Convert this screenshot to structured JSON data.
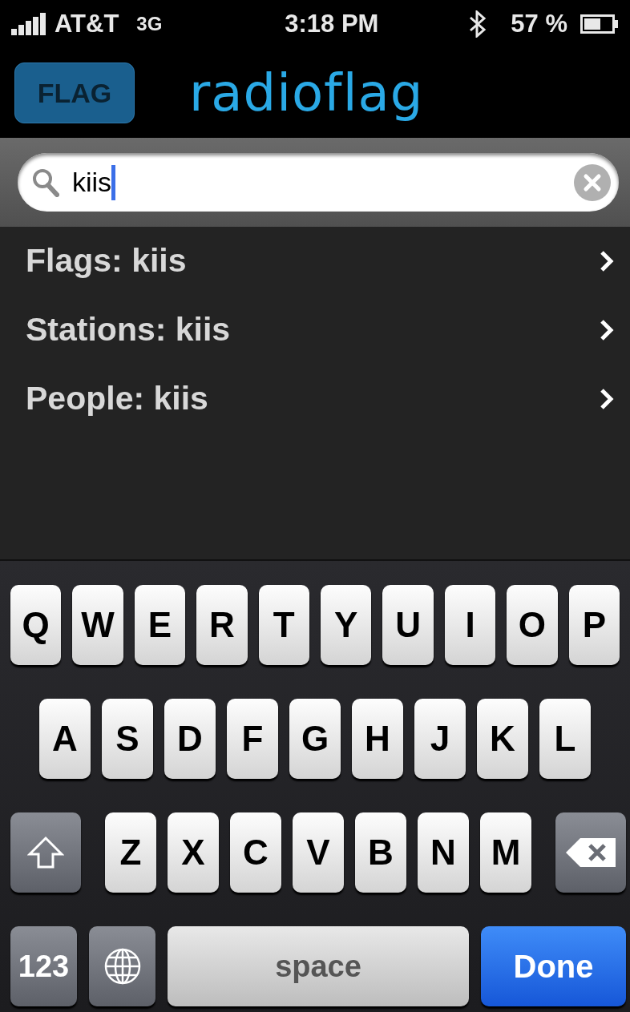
{
  "status_bar": {
    "carrier": "AT&T",
    "network": "3G",
    "time": "3:18 PM",
    "battery": "57 %"
  },
  "header": {
    "flag_button": "FLAG",
    "logo": "radioflag"
  },
  "search": {
    "value": "kiis"
  },
  "results": [
    {
      "label": "Flags: kiis"
    },
    {
      "label": "Stations: kiis"
    },
    {
      "label": "People: kiis"
    }
  ],
  "keyboard": [
    [
      {
        "kind": "letter",
        "label": "Q"
      },
      {
        "kind": "letter",
        "label": "W"
      },
      {
        "kind": "letter",
        "label": "E"
      },
      {
        "kind": "letter",
        "label": "R"
      },
      {
        "kind": "letter",
        "label": "T"
      },
      {
        "kind": "letter",
        "label": "Y"
      },
      {
        "kind": "letter",
        "label": "U"
      },
      {
        "kind": "letter",
        "label": "I"
      },
      {
        "kind": "letter",
        "label": "O"
      },
      {
        "kind": "letter",
        "label": "P"
      }
    ],
    [
      {
        "kind": "letter",
        "label": "A"
      },
      {
        "kind": "letter",
        "label": "S"
      },
      {
        "kind": "letter",
        "label": "D"
      },
      {
        "kind": "letter",
        "label": "F"
      },
      {
        "kind": "letter",
        "label": "G"
      },
      {
        "kind": "letter",
        "label": "H"
      },
      {
        "kind": "letter",
        "label": "J"
      },
      {
        "kind": "letter",
        "label": "K"
      },
      {
        "kind": "letter",
        "label": "L"
      }
    ],
    [
      {
        "kind": "shift"
      },
      {
        "kind": "letter",
        "label": "Z"
      },
      {
        "kind": "letter",
        "label": "X"
      },
      {
        "kind": "letter",
        "label": "C"
      },
      {
        "kind": "letter",
        "label": "V"
      },
      {
        "kind": "letter",
        "label": "B"
      },
      {
        "kind": "letter",
        "label": "N"
      },
      {
        "kind": "letter",
        "label": "M"
      },
      {
        "kind": "delete"
      }
    ],
    [
      {
        "kind": "numbers",
        "label": "123"
      },
      {
        "kind": "globe"
      },
      {
        "kind": "space",
        "label": "space"
      },
      {
        "kind": "done",
        "label": "Done"
      }
    ]
  ]
}
